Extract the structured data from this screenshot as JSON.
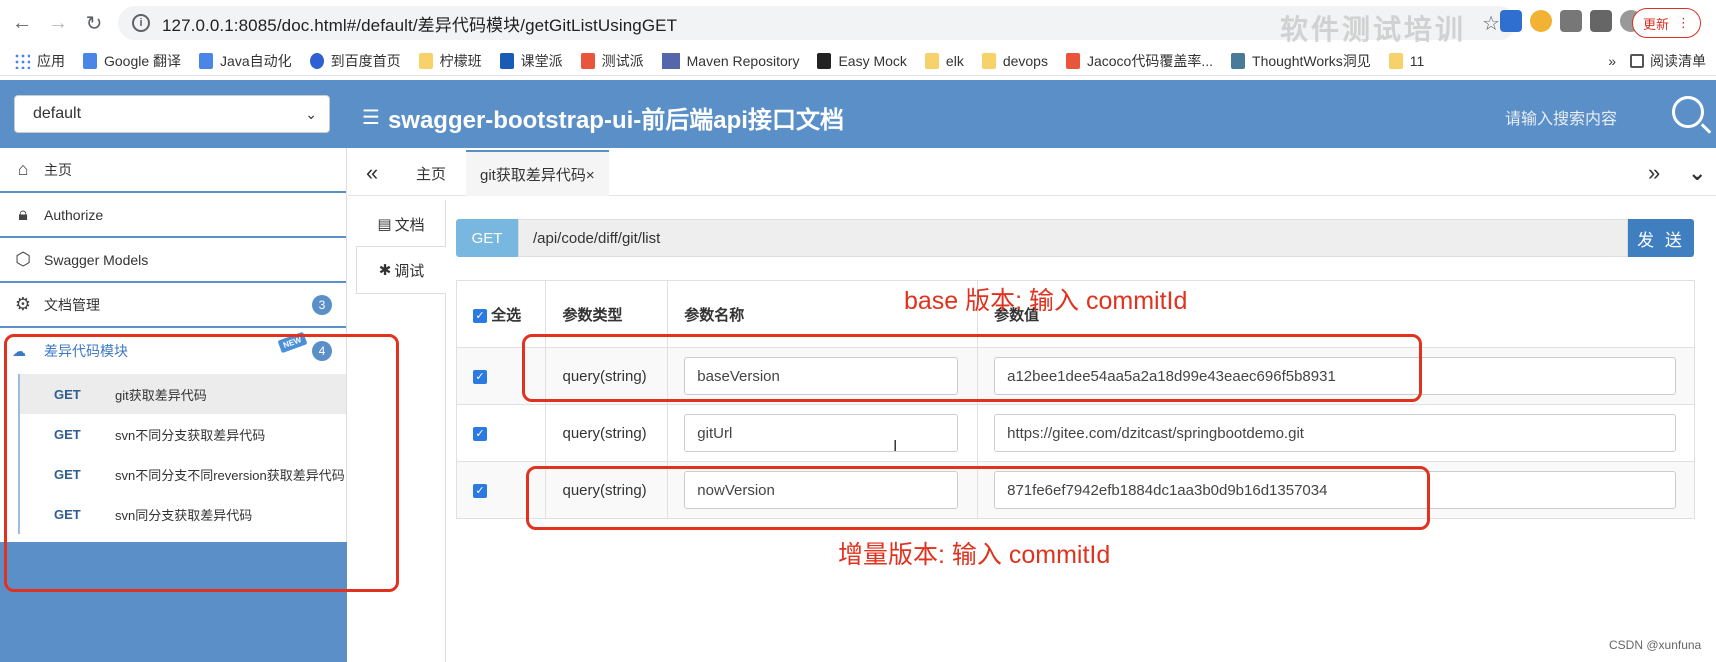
{
  "browser": {
    "url": "127.0.0.1:8085/doc.html#/default/差异代码模块/getGitListUsingGET",
    "update_label": "更新",
    "watermark": "软件测试培训",
    "bookmarks": [
      "应用",
      "Google 翻译",
      "Java自动化",
      "到百度首页",
      "柠檬班",
      "课堂派",
      "测试派",
      "Maven Repository",
      "Easy Mock",
      "elk",
      "devops",
      "Jacoco代码覆盖率...",
      "ThoughtWorks洞见",
      "11"
    ],
    "bookmarks_more": "»",
    "reading_list": "阅读清单"
  },
  "header": {
    "group_select": "default",
    "title": "swagger-bootstrap-ui-前后端api接口文档",
    "search_placeholder": "请输入搜索内容"
  },
  "sidebar": {
    "items": [
      {
        "label": "主页",
        "icon": "home-icon"
      },
      {
        "label": "Authorize",
        "icon": "lock-icon"
      },
      {
        "label": "Swagger Models",
        "icon": "cube-icon"
      },
      {
        "label": "文档管理",
        "icon": "doc-settings-icon",
        "badge": "3"
      }
    ],
    "module": {
      "label": "差异代码模块",
      "new_badge": "NEW",
      "badge": "4",
      "icon": "cloud-icon"
    },
    "apis": [
      {
        "method": "GET",
        "label": "git获取差异代码",
        "active": true
      },
      {
        "method": "GET",
        "label": "svn不同分支获取差异代码",
        "active": false
      },
      {
        "method": "GET",
        "label": "svn不同分支不同reversion获取差异代码",
        "active": false
      },
      {
        "method": "GET",
        "label": "svn同分支获取差异代码",
        "active": false
      }
    ]
  },
  "tabs": {
    "prev": "«",
    "next": "»",
    "collapse": "⌄",
    "items": [
      {
        "label": "主页",
        "active": false
      },
      {
        "label": "git获取差异代码×",
        "active": true
      }
    ]
  },
  "subtabs": [
    {
      "label": "文档",
      "icon": "document-icon"
    },
    {
      "label": "调试",
      "icon": "bug-icon"
    }
  ],
  "request": {
    "method": "GET",
    "url": "/api/code/diff/git/list",
    "send_label": "发 送"
  },
  "params": {
    "headers": {
      "select_all": "全选",
      "type": "参数类型",
      "name": "参数名称",
      "value": "参数值"
    },
    "rows": [
      {
        "type": "query(string)",
        "name": "baseVersion",
        "value": "a12bee1dee54aa5a2a18d99e43eaec696f5b8931"
      },
      {
        "type": "query(string)",
        "name": "gitUrl",
        "value": "https://gitee.com/dzitcast/springbootdemo.git"
      },
      {
        "type": "query(string)",
        "name": "nowVersion",
        "value": "871fe6ef7942efb1884dc1aa3b0d9b16d1357034"
      }
    ]
  },
  "annotations": {
    "base": "base 版本: 输入 commitId",
    "increment": "增量版本: 输入 commitId"
  },
  "footer": {
    "csdn": "CSDN @xunfuna"
  },
  "colors": {
    "header_blue": "#5b8fc7",
    "annotation_red": "#e0321e",
    "method_get": "#78b8e0",
    "send_blue": "#3f7fc0"
  }
}
